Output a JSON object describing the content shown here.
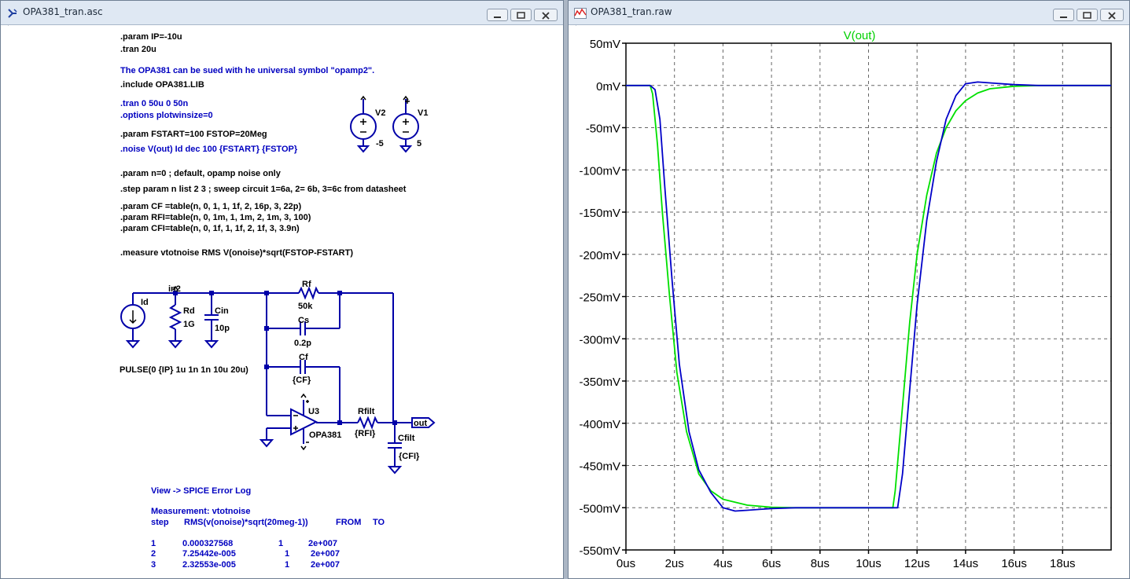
{
  "left_window": {
    "title": "OPA381_tran.asc",
    "directives": [
      {
        "text": ".param IP=-10u",
        "color": "#000000"
      },
      {
        "text": ".tran 20u",
        "color": "#000000"
      },
      {
        "text": "The OPA381 can be sued with he universal symbol \"opamp2\".",
        "color": "#0000c0"
      },
      {
        "text": ".include  OPA381.LIB",
        "color": "#000000"
      },
      {
        "text": ".tran 0 50u 0 50n",
        "color": "#0000c0"
      },
      {
        "text": ".options plotwinsize=0",
        "color": "#0000c0"
      },
      {
        "text": ".param FSTART=100 FSTOP=20Meg",
        "color": "#000000"
      },
      {
        "text": ".noise V(out) Id dec 100 {FSTART} {FSTOP}",
        "color": "#0000c0"
      },
      {
        "text": ".param n=0 ; default, opamp noise only",
        "color": "#000000"
      },
      {
        "text": ".step param n list 2 3 ; sweep circuit 1=6a, 2= 6b, 3=6c from datasheet",
        "color": "#000000"
      },
      {
        "text": ".param CF =table(n, 0, 1, 1, 1f, 2, 16p, 3, 22p)",
        "color": "#000000"
      },
      {
        "text": ".param RFI=table(n, 0, 1m, 1, 1m, 2, 1m, 3, 100)",
        "color": "#000000"
      },
      {
        "text": ".param CFI=table(n, 0, 1f, 1, 1f, 2, 1f, 3, 3.9n)",
        "color": "#000000"
      },
      {
        "text": ".measure vtotnoise RMS V(onoise)*sqrt(FSTOP-FSTART)",
        "color": "#000000"
      }
    ],
    "components": {
      "v2": {
        "name": "V2",
        "value": "-5"
      },
      "v1": {
        "name": "V1",
        "value": "5"
      },
      "id": {
        "name": "Id",
        "value": "PULSE(0 {IP} 1u 1n 1n 10u 20u)"
      },
      "net_in2": "in2",
      "rd": {
        "name": "Rd",
        "value": "1G"
      },
      "cin": {
        "name": "Cin",
        "value": "10p"
      },
      "rf": {
        "name": "Rf",
        "value": "50k"
      },
      "cs": {
        "name": "Cs",
        "value": "0.2p"
      },
      "cf": {
        "name": "Cf",
        "value": "{CF}"
      },
      "u3": {
        "name": "U3",
        "value": "OPA381"
      },
      "rfilt": {
        "name": "Rfilt",
        "value": "{RFI}"
      },
      "cfilt": {
        "name": "Cfilt",
        "value": "{CFI}"
      },
      "out_label": "out"
    },
    "log": {
      "view_hint": "View -> SPICE Error Log",
      "measurement_title": "Measurement: vtotnoise",
      "header": [
        "step",
        "RMS(v(onoise)*sqrt(20meg-1))",
        "FROM",
        "TO"
      ],
      "rows": [
        [
          "1",
          "0.000327568",
          "1",
          "2e+007"
        ],
        [
          "2",
          "7.25442e-005",
          "1",
          "2e+007"
        ],
        [
          "3",
          "2.32553e-005",
          "1",
          "2e+007"
        ]
      ]
    },
    "colors": {
      "wire": "#0000a8",
      "text": "#000000",
      "comment": "#0000c0"
    }
  },
  "right_window": {
    "title": "OPA381_tran.raw",
    "chart_data": {
      "type": "line",
      "title": "V(out)",
      "xlabel": "",
      "ylabel": "",
      "xlim": [
        0,
        20
      ],
      "ylim": [
        -550,
        50
      ],
      "x_unit": "us",
      "y_unit": "mV",
      "x_ticks": [
        "0us",
        "2us",
        "4us",
        "6us",
        "8us",
        "10us",
        "12us",
        "14us",
        "16us",
        "18us"
      ],
      "y_ticks": [
        "50mV",
        "0mV",
        "-50mV",
        "-100mV",
        "-150mV",
        "-200mV",
        "-250mV",
        "-300mV",
        "-350mV",
        "-400mV",
        "-450mV",
        "-500mV",
        "-550mV"
      ],
      "grid": true,
      "series": [
        {
          "color": "#00e000",
          "points": [
            [
              0,
              0
            ],
            [
              1.0,
              0
            ],
            [
              1.1,
              -10
            ],
            [
              1.3,
              -70
            ],
            [
              1.5,
              -150
            ],
            [
              1.8,
              -250
            ],
            [
              2.1,
              -340
            ],
            [
              2.5,
              -410
            ],
            [
              3.0,
              -460
            ],
            [
              3.5,
              -480
            ],
            [
              4.0,
              -490
            ],
            [
              5.0,
              -497
            ],
            [
              6.0,
              -499.5
            ],
            [
              7.0,
              -500
            ],
            [
              11.0,
              -500
            ],
            [
              11.1,
              -480
            ],
            [
              11.4,
              -380
            ],
            [
              11.7,
              -280
            ],
            [
              12.0,
              -200
            ],
            [
              12.4,
              -130
            ],
            [
              12.8,
              -80
            ],
            [
              13.2,
              -50
            ],
            [
              13.6,
              -30
            ],
            [
              14.0,
              -18
            ],
            [
              14.5,
              -9
            ],
            [
              15.0,
              -4
            ],
            [
              16.0,
              -1
            ],
            [
              17.0,
              0
            ],
            [
              20.0,
              0
            ]
          ]
        },
        {
          "color": "#0000c8",
          "points": [
            [
              0,
              0
            ],
            [
              1.0,
              0
            ],
            [
              1.2,
              -5
            ],
            [
              1.4,
              -40
            ],
            [
              1.6,
              -120
            ],
            [
              1.9,
              -230
            ],
            [
              2.2,
              -330
            ],
            [
              2.6,
              -410
            ],
            [
              3.0,
              -455
            ],
            [
              3.5,
              -482
            ],
            [
              4.0,
              -500
            ],
            [
              4.5,
              -504
            ],
            [
              5.0,
              -503
            ],
            [
              5.5,
              -502
            ],
            [
              6.0,
              -501
            ],
            [
              7.0,
              -500
            ],
            [
              11.0,
              -500
            ],
            [
              11.2,
              -500
            ],
            [
              11.4,
              -460
            ],
            [
              11.7,
              -360
            ],
            [
              12.0,
              -260
            ],
            [
              12.4,
              -160
            ],
            [
              12.8,
              -90
            ],
            [
              13.2,
              -40
            ],
            [
              13.6,
              -12
            ],
            [
              14.0,
              2
            ],
            [
              14.5,
              4
            ],
            [
              15.0,
              3
            ],
            [
              16.0,
              1
            ],
            [
              17.0,
              0
            ],
            [
              20.0,
              0
            ]
          ]
        }
      ]
    }
  }
}
